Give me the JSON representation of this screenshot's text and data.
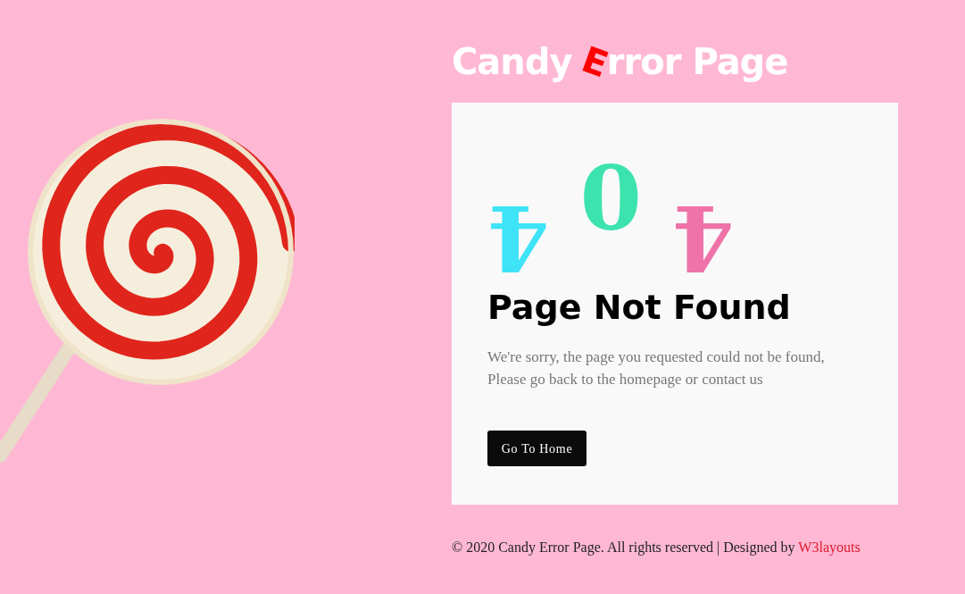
{
  "title": {
    "before": "Candy ",
    "accent": "E",
    "after": "rror Page"
  },
  "digits": [
    {
      "text": "4",
      "kind": "flipped",
      "color": "#3ee3f7"
    },
    {
      "text": "0",
      "kind": "upright",
      "color": "#3de3ae"
    },
    {
      "text": "4",
      "kind": "flipped",
      "color": "#ef72a8"
    }
  ],
  "heading": "Page Not Found",
  "message": [
    "We're sorry, the page you requested could not be found,",
    "Please go back to the homepage or contact us"
  ],
  "button": "Go To Home",
  "footer": {
    "text": "© 2020 Candy Error Page. All rights reserved | Designed by ",
    "link": "W3layouts"
  }
}
